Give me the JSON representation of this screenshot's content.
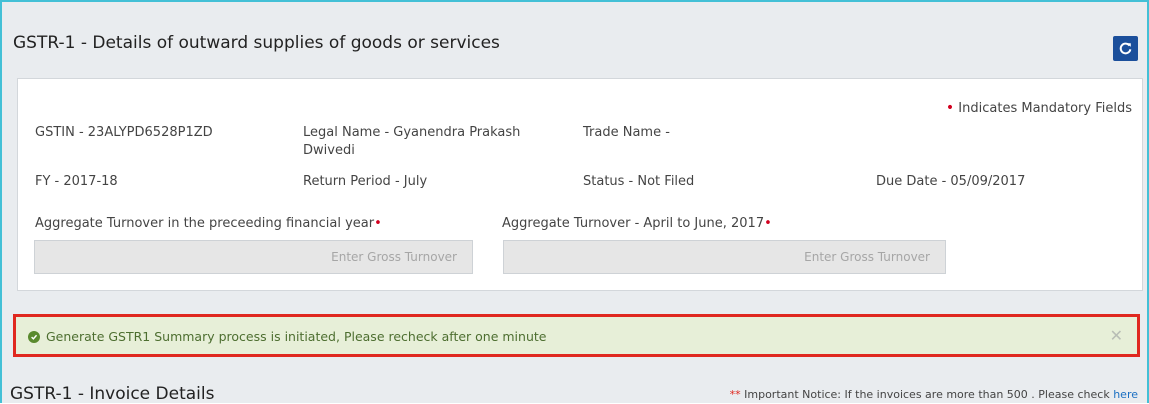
{
  "header": {
    "title": "GSTR-1 - Details of outward supplies of goods or services",
    "refresh_icon": "refresh-icon"
  },
  "details": {
    "mandatory_note": "Indicates Mandatory Fields",
    "gstin": "GSTIN - 23ALYPD6528P1ZD",
    "legal_name_line1": "Legal Name - Gyanendra Prakash",
    "legal_name_line2": "Dwivedi",
    "trade_name": "Trade Name -",
    "fy": "FY - 2017-18",
    "return_period": "Return Period -  July",
    "status": "Status - Not Filed",
    "due_date": "Due Date -  05/09/2017"
  },
  "turnover": {
    "prev_label": "Aggregate Turnover in the preceeding financial year",
    "apr_jun_label": "Aggregate Turnover - April to June, 2017",
    "prev_placeholder": "Enter Gross Turnover",
    "apr_jun_placeholder": "Enter Gross Turnover",
    "required_marker": "•"
  },
  "alert": {
    "message": "Generate GSTR1 Summary process is initiated, Please recheck after one minute",
    "close_symbol": "✕"
  },
  "invoice": {
    "title": "GSTR-1 - Invoice Details",
    "notice_stars": "**",
    "notice_text": " Important Notice: If the invoices are more than 500 . Please check ",
    "notice_link": "here"
  },
  "colors": {
    "frame_border": "#43c0d6",
    "refresh_button": "#1b4f9b",
    "alert_border": "#e0281f",
    "alert_bg": "#e7efd8",
    "required": "#d2001f"
  }
}
